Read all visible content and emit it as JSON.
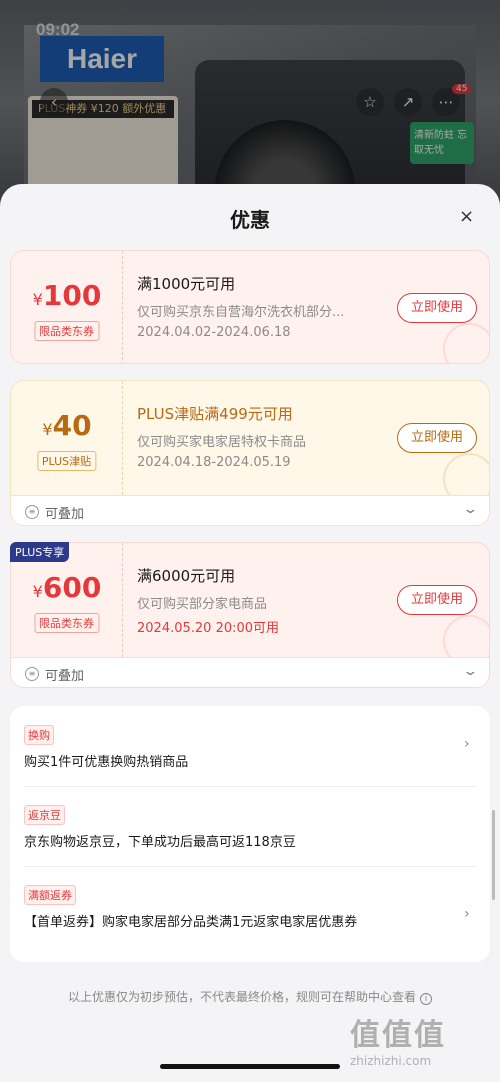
{
  "background": {
    "time": "09:02",
    "brand": "Haier",
    "promo_plus": "PLUS神券 ¥120 额外优惠",
    "badge_count": "45",
    "green_tag": "清新防蛀 忘取无忧"
  },
  "sheet": {
    "title": "优惠",
    "close": "×"
  },
  "coupons": [
    {
      "currency": "¥",
      "amount": "100",
      "tag": "限品类东券",
      "title": "满1000元可用",
      "desc": "仅可购买京东自营海尔洗衣机部分...",
      "date": "2024.04.02-2024.06.18",
      "button": "立即使用"
    },
    {
      "currency": "¥",
      "amount": "40",
      "tag": "PLUS津贴",
      "title": "PLUS津贴满499元可用",
      "desc": "仅可购买家电家居特权卡商品",
      "date": "2024.04.18-2024.05.19",
      "button": "立即使用",
      "stack_label": "可叠加"
    },
    {
      "badge": "PLUS专享",
      "currency": "¥",
      "amount": "600",
      "tag": "限品类东券",
      "title": "满6000元可用",
      "desc": "仅可购买部分家电商品",
      "date": "2024.05.20 20:00可用",
      "button": "立即使用",
      "stack_label": "可叠加"
    }
  ],
  "benefits": [
    {
      "tag": "换购",
      "text": "购买1件可优惠换购热销商品"
    },
    {
      "tag": "返京豆",
      "text": "京东购物返京豆，下单成功后最高可返118京豆"
    },
    {
      "tag": "满额返券",
      "text": "【首单返券】购家电家居部分品类满1元返家电家居优惠券"
    }
  ],
  "footer": "以上优惠仅为初步预估，不代表最终价格，规则可在帮助中心查看",
  "watermark": {
    "glyphs": "值值值",
    "site": "zhizhizhi.com"
  }
}
